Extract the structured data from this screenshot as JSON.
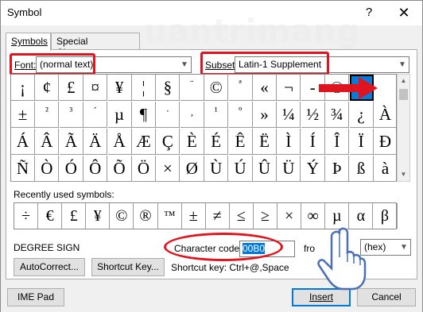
{
  "window": {
    "title": "Symbol",
    "help_glyph": "?",
    "close_glyph": "✕"
  },
  "watermark": "uantrimang",
  "tabs": [
    "Symbols",
    "Special Characters"
  ],
  "font": {
    "label": "Font:",
    "value": "(normal text)"
  },
  "subset": {
    "label": "Subset:",
    "value": "Latin-1 Supplement"
  },
  "grid_rows": [
    [
      "¡",
      "¢",
      "£",
      "¤",
      "¥",
      "¦",
      "§",
      "¨",
      "©",
      "ª",
      "«",
      "¬",
      "-",
      "®",
      "°"
    ],
    [
      "±",
      "²",
      "³",
      "´",
      "µ",
      "¶",
      "·",
      "¸",
      "¹",
      "º",
      "»",
      "¼",
      "½",
      "¾",
      "¿",
      "À"
    ],
    [
      "Á",
      "Â",
      "Ã",
      "Ä",
      "Å",
      "Æ",
      "Ç",
      "È",
      "É",
      "Ê",
      "Ë",
      "Ì",
      "Í",
      "Î",
      "Ï",
      "Ð"
    ],
    [
      "Ñ",
      "Ò",
      "Ó",
      "Ô",
      "Õ",
      "Ö",
      "×",
      "Ø",
      "Ù",
      "Ú",
      "Û",
      "Ü",
      "Ý",
      "Þ",
      "ß",
      "à"
    ]
  ],
  "recent": {
    "label": "Recently used symbols:",
    "symbols": [
      "÷",
      "€",
      "£",
      "¥",
      "©",
      "®",
      "™",
      "±",
      "≠",
      "≤",
      "≥",
      "×",
      "∞",
      "µ",
      "α",
      "β"
    ]
  },
  "char_name": "DEGREE SIGN",
  "character_code": {
    "label": "Character code:",
    "value": "00B0"
  },
  "from": {
    "label": "fro",
    "value": "(hex)"
  },
  "buttons": {
    "autocorrect": "AutoCorrect...",
    "shortcut_key": "Shortcut Key...",
    "ime_pad": "IME Pad",
    "insert": "Insert",
    "cancel": "Cancel"
  },
  "shortcut_text": "Shortcut key: Ctrl+@,Space",
  "colors": {
    "accent": "#0078d7",
    "annotation_red": "#e0141e",
    "selection": "#0a7ad6"
  }
}
